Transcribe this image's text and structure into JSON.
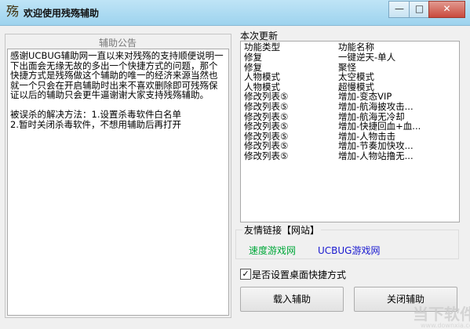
{
  "window": {
    "title": "欢迎使用残殇辅助",
    "app_icon_glyph": "殇",
    "minimize_glyph": "—",
    "maximize_glyph": "□",
    "close_glyph": "✕"
  },
  "notice": {
    "title": "辅助公告",
    "text": "感谢UCBUG辅助网一直以来对残殇的支持顺便说明一下出面会无缘无故的多出一个快捷方式的问题，那个快捷方式是残殇做这个辅助的唯一的经济来源当然也就一个只会在开启辅助时出来不喜欢删除即可残殇保证以后的辅助只会更牛逼谢谢大家支持残殇辅助。\n\n被误杀的解决方法：1.设置杀毒软件白名单\n2.暂时关闭杀毒软件，不想用辅助后再打开"
  },
  "updates": {
    "title": "本次更新",
    "columns": [
      "功能类型",
      "功能名称"
    ],
    "rows": [
      {
        "type": "修复",
        "name": "一键逆天-单人"
      },
      {
        "type": "修复",
        "name": "聚怪"
      },
      {
        "type": "人物模式",
        "name": "太空模式"
      },
      {
        "type": "人物模式",
        "name": "超慢模式"
      },
      {
        "type": "修改列表⑤",
        "name": "增加-变态VIP"
      },
      {
        "type": "修改列表⑤",
        "name": "增加-航海披攻击..."
      },
      {
        "type": "修改列表⑤",
        "name": "增加-航海无冷却"
      },
      {
        "type": "修改列表⑤",
        "name": "增加-快捷回血+血..."
      },
      {
        "type": "修改列表⑤",
        "name": "增加-人物击击"
      },
      {
        "type": "修改列表⑤",
        "name": "增加-节奏加快攻..."
      },
      {
        "type": "修改列表⑤",
        "name": "增加-人物站撸无..."
      }
    ]
  },
  "links": {
    "label": "友情链接【网站】",
    "items": [
      "速度游戏网",
      "UCBUG游戏网"
    ]
  },
  "shortcut_checkbox": {
    "label": "是否设置桌面快捷方式",
    "checked_glyph": "✓"
  },
  "buttons": {
    "load": "载入辅助",
    "close": "关闭辅助"
  },
  "watermark": {
    "main": "当下软件园",
    "sub": "www.downxia.com"
  }
}
